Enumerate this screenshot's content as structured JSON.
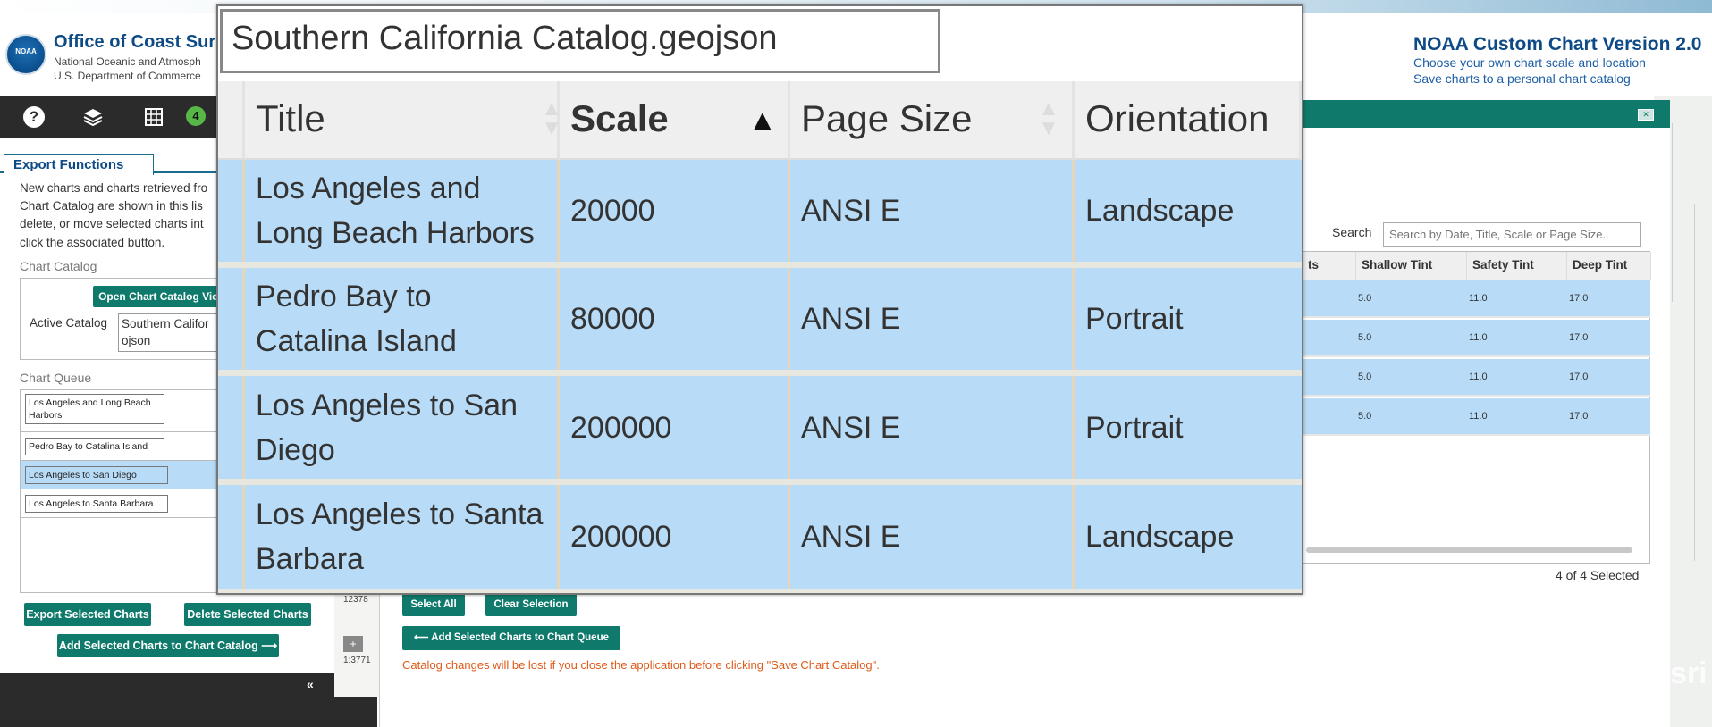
{
  "header": {
    "org_title": "Office of Coast Sur",
    "org_sub1": "National Oceanic and Atmosph",
    "org_sub2": "U.S. Department of Commerce",
    "logo_text": "NOAA",
    "app_title": "NOAA Custom Chart Version 2.0",
    "app_line1": "Choose your own chart scale and location",
    "app_line2": "Save charts to a personal chart catalog"
  },
  "toolbar": {
    "help": "?",
    "layers_icon": "layers-icon",
    "grid_icon": "grid-icon",
    "badge_count": "4"
  },
  "left_panel": {
    "tab_label": "Export Functions",
    "desc_lines": [
      "New charts and charts retrieved fro",
      "Chart Catalog are shown in this lis",
      "delete, or move selected charts int",
      "click the associated button."
    ],
    "chart_catalog_label": "Chart Catalog",
    "open_viewer_button": "Open Chart Catalog Vie",
    "active_catalog_label": "Active Catalog",
    "active_catalog_value": "Southern Califor ojson",
    "chart_queue_label": "Chart Queue",
    "queue_items": [
      {
        "label": "Los Angeles and Long Beach Harbors",
        "selected": false
      },
      {
        "label": "Pedro Bay to Catalina Island",
        "selected": false
      },
      {
        "label": "Los Angeles to San Diego",
        "selected": true
      },
      {
        "label": "Los Angeles to Santa Barbara",
        "selected": false
      }
    ],
    "export_button": "Export Selected Charts",
    "delete_button": "Delete Selected Charts",
    "add_to_catalog_button": "Add Selected Charts to Chart Catalog  ⟶",
    "collapse": "«"
  },
  "map": {
    "label1": "12378",
    "zoom_label": "+",
    "label2": "1:3771",
    "esri": "sri"
  },
  "viewer": {
    "search_label": "Search",
    "search_placeholder": "Search by Date, Title, Scale or Page Size..",
    "columns": [
      "ts",
      "Shallow Tint",
      "Safety Tint",
      "Deep Tint"
    ],
    "rows": [
      [
        "5.0",
        "11.0",
        "17.0"
      ],
      [
        "5.0",
        "11.0",
        "17.0"
      ],
      [
        "5.0",
        "11.0",
        "17.0"
      ],
      [
        "5.0",
        "11.0",
        "17.0"
      ]
    ],
    "selected_count": "4 of 4 Selected",
    "select_all": "Select All",
    "clear_selection": "Clear Selection",
    "add_to_queue": "⟵  Add Selected Charts to Chart Queue",
    "warning": "Catalog changes will be lost if you close the application before clicking \"Save Chart Catalog\"."
  },
  "overlay": {
    "catalog_name": "Southern California Catalog.geojson",
    "columns": [
      "Title",
      "Scale",
      "Page Size",
      "Orientation"
    ],
    "sort_active_glyph": "▲",
    "rows": [
      {
        "title": "Los Angeles and Long Beach Harbors",
        "scale": "20000",
        "page_size": "ANSI E",
        "orientation": "Landscape"
      },
      {
        "title": "Pedro Bay to Catalina Island",
        "scale": "80000",
        "page_size": "ANSI E",
        "orientation": "Portrait"
      },
      {
        "title": "Los Angeles to San Diego",
        "scale": "200000",
        "page_size": "ANSI E",
        "orientation": "Portrait"
      },
      {
        "title": "Los Angeles to Santa Barbara",
        "scale": "200000",
        "page_size": "ANSI E",
        "orientation": "Landscape"
      }
    ]
  },
  "colors": {
    "teal_button": "#0f7a6b",
    "selected_row": "#b8dcf7",
    "noaa_blue": "#0d4a86",
    "warning_orange": "#e05a1a"
  }
}
